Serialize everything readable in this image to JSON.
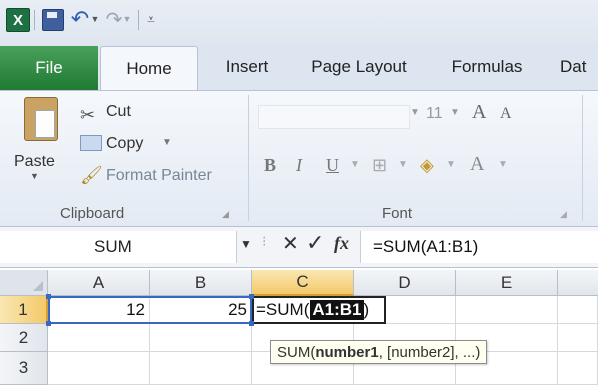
{
  "qat": {
    "logo": "X",
    "undo_glyph": "↶",
    "redo_glyph": "↷",
    "dropdown_glyph": "▼",
    "customize_glyph": "⩡"
  },
  "tabs": [
    {
      "label": "File"
    },
    {
      "label": "Home"
    },
    {
      "label": "Insert"
    },
    {
      "label": "Page Layout"
    },
    {
      "label": "Formulas"
    },
    {
      "label": "Dat"
    }
  ],
  "ribbon": {
    "clipboard": {
      "paste_label": "Paste",
      "cut_label": "Cut",
      "copy_label": "Copy",
      "format_painter_label": "Format Painter",
      "group_label": "Clipboard"
    },
    "font": {
      "size_value": "11",
      "grow_glyph": "A",
      "shrink_glyph": "A",
      "bold_glyph": "B",
      "italic_glyph": "I",
      "underline_glyph": "U",
      "font_color_glyph": "A",
      "group_label": "Font"
    }
  },
  "formula_bar": {
    "name_box": "SUM",
    "cancel_glyph": "✕",
    "enter_glyph": "✓",
    "fx_label": "fx",
    "formula": "=SUM(A1:B1)"
  },
  "grid": {
    "columns": [
      "A",
      "B",
      "C",
      "D",
      "E"
    ],
    "rows": [
      "1",
      "2",
      "3"
    ],
    "cells": {
      "A1": "12",
      "B1": "25"
    },
    "editing_prefix": "=SUM(",
    "editing_ref": "A1:B1",
    "editing_suffix": ")"
  },
  "tooltip": {
    "func": "SUM(",
    "arg1": "number1",
    "rest": ", [number2], ...)"
  },
  "colors": {
    "file_tab": "#1f7a33",
    "active_header": "#f4c96a",
    "range_highlight": "#3968c4"
  }
}
